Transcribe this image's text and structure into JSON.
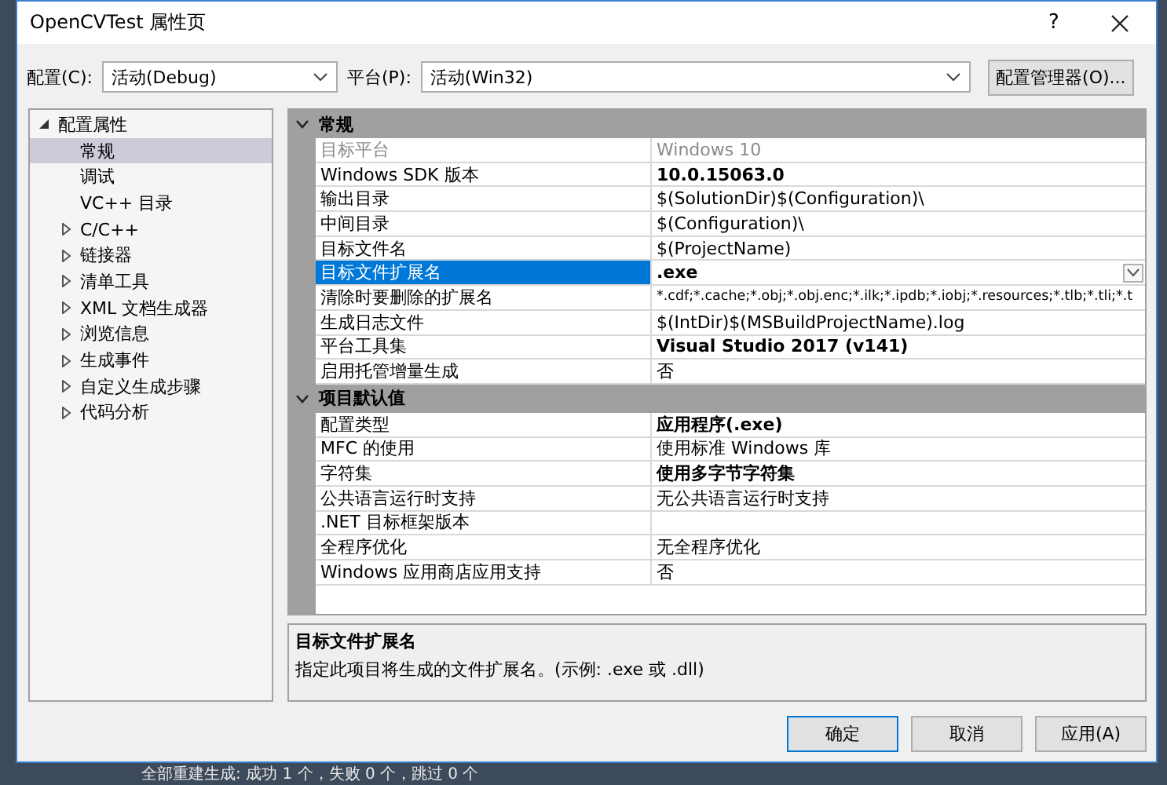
{
  "window": {
    "title": "OpenCVTest 属性页",
    "help": "?"
  },
  "config": {
    "label": "配置(C):",
    "value": "活动(Debug)"
  },
  "platform": {
    "label": "平台(P):",
    "value": "活动(Win32)"
  },
  "config_manager": "配置管理器(O)...",
  "tree": [
    {
      "label": "配置属性",
      "expanded": true,
      "selected": false,
      "children": [
        {
          "label": "常规",
          "selected": true
        },
        {
          "label": "调试",
          "selected": false
        },
        {
          "label": "VC++ 目录",
          "selected": false
        },
        {
          "label": "C/C++",
          "selected": false,
          "expanded": false
        },
        {
          "label": "链接器",
          "selected": false,
          "expanded": false
        },
        {
          "label": "清单工具",
          "selected": false,
          "expanded": false
        },
        {
          "label": "XML 文档生成器",
          "selected": false,
          "expanded": false
        },
        {
          "label": "浏览信息",
          "selected": false,
          "expanded": false
        },
        {
          "label": "生成事件",
          "selected": false,
          "expanded": false
        },
        {
          "label": "自定义生成步骤",
          "selected": false,
          "expanded": false
        },
        {
          "label": "代码分析",
          "selected": false,
          "expanded": false
        }
      ]
    }
  ],
  "grid": [
    {
      "title": "常规",
      "expanded": true,
      "rows": [
        {
          "name": "目标平台",
          "value": "Windows 10",
          "disabled": true,
          "bold": false,
          "selected": false
        },
        {
          "name": "Windows SDK 版本",
          "value": "10.0.15063.0",
          "disabled": false,
          "bold": true,
          "selected": false
        },
        {
          "name": "输出目录",
          "value": "$(SolutionDir)$(Configuration)\\",
          "disabled": false,
          "bold": false,
          "selected": false
        },
        {
          "name": "中间目录",
          "value": "$(Configuration)\\",
          "disabled": false,
          "bold": false,
          "selected": false
        },
        {
          "name": "目标文件名",
          "value": "$(ProjectName)",
          "disabled": false,
          "bold": false,
          "selected": false
        },
        {
          "name": "目标文件扩展名",
          "value": ".exe",
          "disabled": false,
          "bold": true,
          "selected": true
        },
        {
          "name": "清除时要删除的扩展名",
          "value": "*.cdf;*.cache;*.obj;*.obj.enc;*.ilk;*.ipdb;*.iobj;*.resources;*.tlb;*.tli;*.t",
          "disabled": false,
          "bold": false,
          "selected": false
        },
        {
          "name": "生成日志文件",
          "value": "$(IntDir)$(MSBuildProjectName).log",
          "disabled": false,
          "bold": false,
          "selected": false
        },
        {
          "name": "平台工具集",
          "value": "Visual Studio 2017 (v141)",
          "disabled": false,
          "bold": true,
          "selected": false
        },
        {
          "name": "启用托管增量生成",
          "value": "否",
          "disabled": false,
          "bold": false,
          "selected": false
        }
      ]
    },
    {
      "title": "项目默认值",
      "expanded": true,
      "rows": [
        {
          "name": "配置类型",
          "value": "应用程序(.exe)",
          "disabled": false,
          "bold": true,
          "selected": false
        },
        {
          "name": "MFC 的使用",
          "value": "使用标准 Windows 库",
          "disabled": false,
          "bold": false,
          "selected": false
        },
        {
          "name": "字符集",
          "value": "使用多字节字符集",
          "disabled": false,
          "bold": true,
          "selected": false
        },
        {
          "name": "公共语言运行时支持",
          "value": "无公共语言运行时支持",
          "disabled": false,
          "bold": false,
          "selected": false
        },
        {
          "name": ".NET 目标框架版本",
          "disabled": false,
          "bold": false,
          "selected": false
        },
        {
          "name": "全程序优化",
          "value": "无全程序优化",
          "disabled": false,
          "bold": false,
          "selected": false
        },
        {
          "name": "Windows 应用商店应用支持",
          "value": "否",
          "disabled": false,
          "bold": false,
          "selected": false
        }
      ]
    }
  ],
  "description": {
    "title": "目标文件扩展名",
    "text": "指定此项目将生成的文件扩展名。(示例: .exe 或 .dll)"
  },
  "buttons": [
    {
      "label": "确定",
      "default": true
    },
    {
      "label": "取消",
      "default": false
    },
    {
      "label": "应用(A)",
      "default": false
    }
  ],
  "background_status": "全部重建生成: 成功 1 个，失败 0 个，跳过 0 个"
}
